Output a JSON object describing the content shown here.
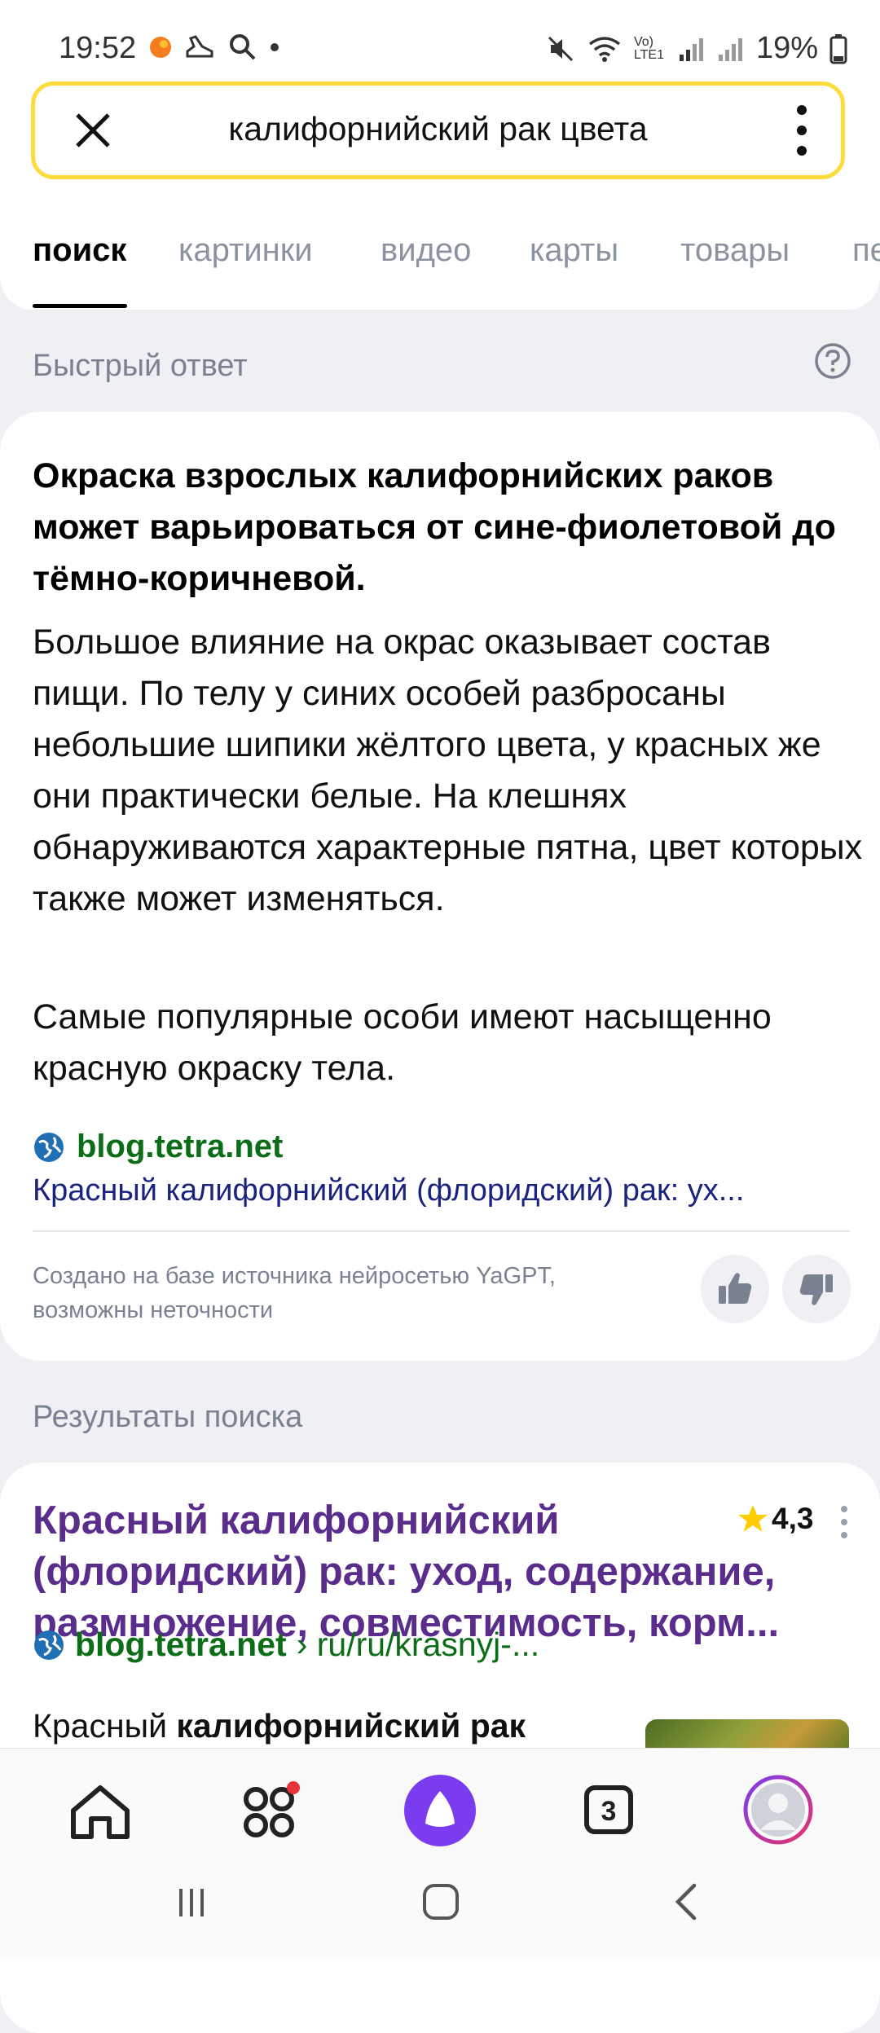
{
  "status_bar": {
    "time": "19:52",
    "battery": "19%",
    "network_label": "Vo) LTE1"
  },
  "search": {
    "query": "калифорнийский рак цвета"
  },
  "tabs": [
    {
      "label": "поиск",
      "active": true
    },
    {
      "label": "картинки",
      "active": false
    },
    {
      "label": "видео",
      "active": false
    },
    {
      "label": "карты",
      "active": false
    },
    {
      "label": "товары",
      "active": false
    },
    {
      "label": "пе",
      "active": false
    }
  ],
  "quick_answer": {
    "section_label": "Быстрый ответ",
    "title": "Окраска взрослых калифорнийских раков может варьироваться от сине-фиолетовой до тёмно-коричневой.",
    "paragraph1": "Большое влияние на окрас оказывает состав пищи. По телу у синих особей разбросаны небольшие шипики жёлтого цвета, у красных же они практически белые. На клешнях обнаруживаются характерные пятна, цвет которых также может изменяться.",
    "paragraph2": "Самые популярные особи имеют насыщенно красную окраску тела.",
    "source_domain": "blog.tetra.net",
    "source_title": "Красный калифорнийский (флоридский) рак: ух...",
    "disclaimer": "Создано на базе источника нейросетью YaGPT, возможны неточности"
  },
  "results": {
    "section_label": "Результаты поиска",
    "items": [
      {
        "title": "Красный калифорнийский (флоридский) рак: уход, содержание, размножение, совместимость, корм...",
        "rating": "4,3",
        "domain": "blog.tetra.net",
        "path": "› ru/ru/krasnyj-...",
        "snippet_plain": "Красный ",
        "snippet_bold": "калифорнийский рак"
      }
    ]
  },
  "bottom_nav": {
    "tabs_count": "3"
  },
  "colors": {
    "search_border": "#fcdb3a",
    "alice_purple": "#7b3cf0",
    "source_green": "#0c6d17",
    "result_title": "#5a2d8c"
  },
  "icons": [
    "close-icon",
    "more-vertical-icon",
    "help-icon",
    "globe-icon",
    "thumbs-up-icon",
    "thumbs-down-icon",
    "star-icon",
    "home-icon",
    "apps-icon",
    "alice-icon",
    "tabs-icon",
    "profile-icon"
  ]
}
